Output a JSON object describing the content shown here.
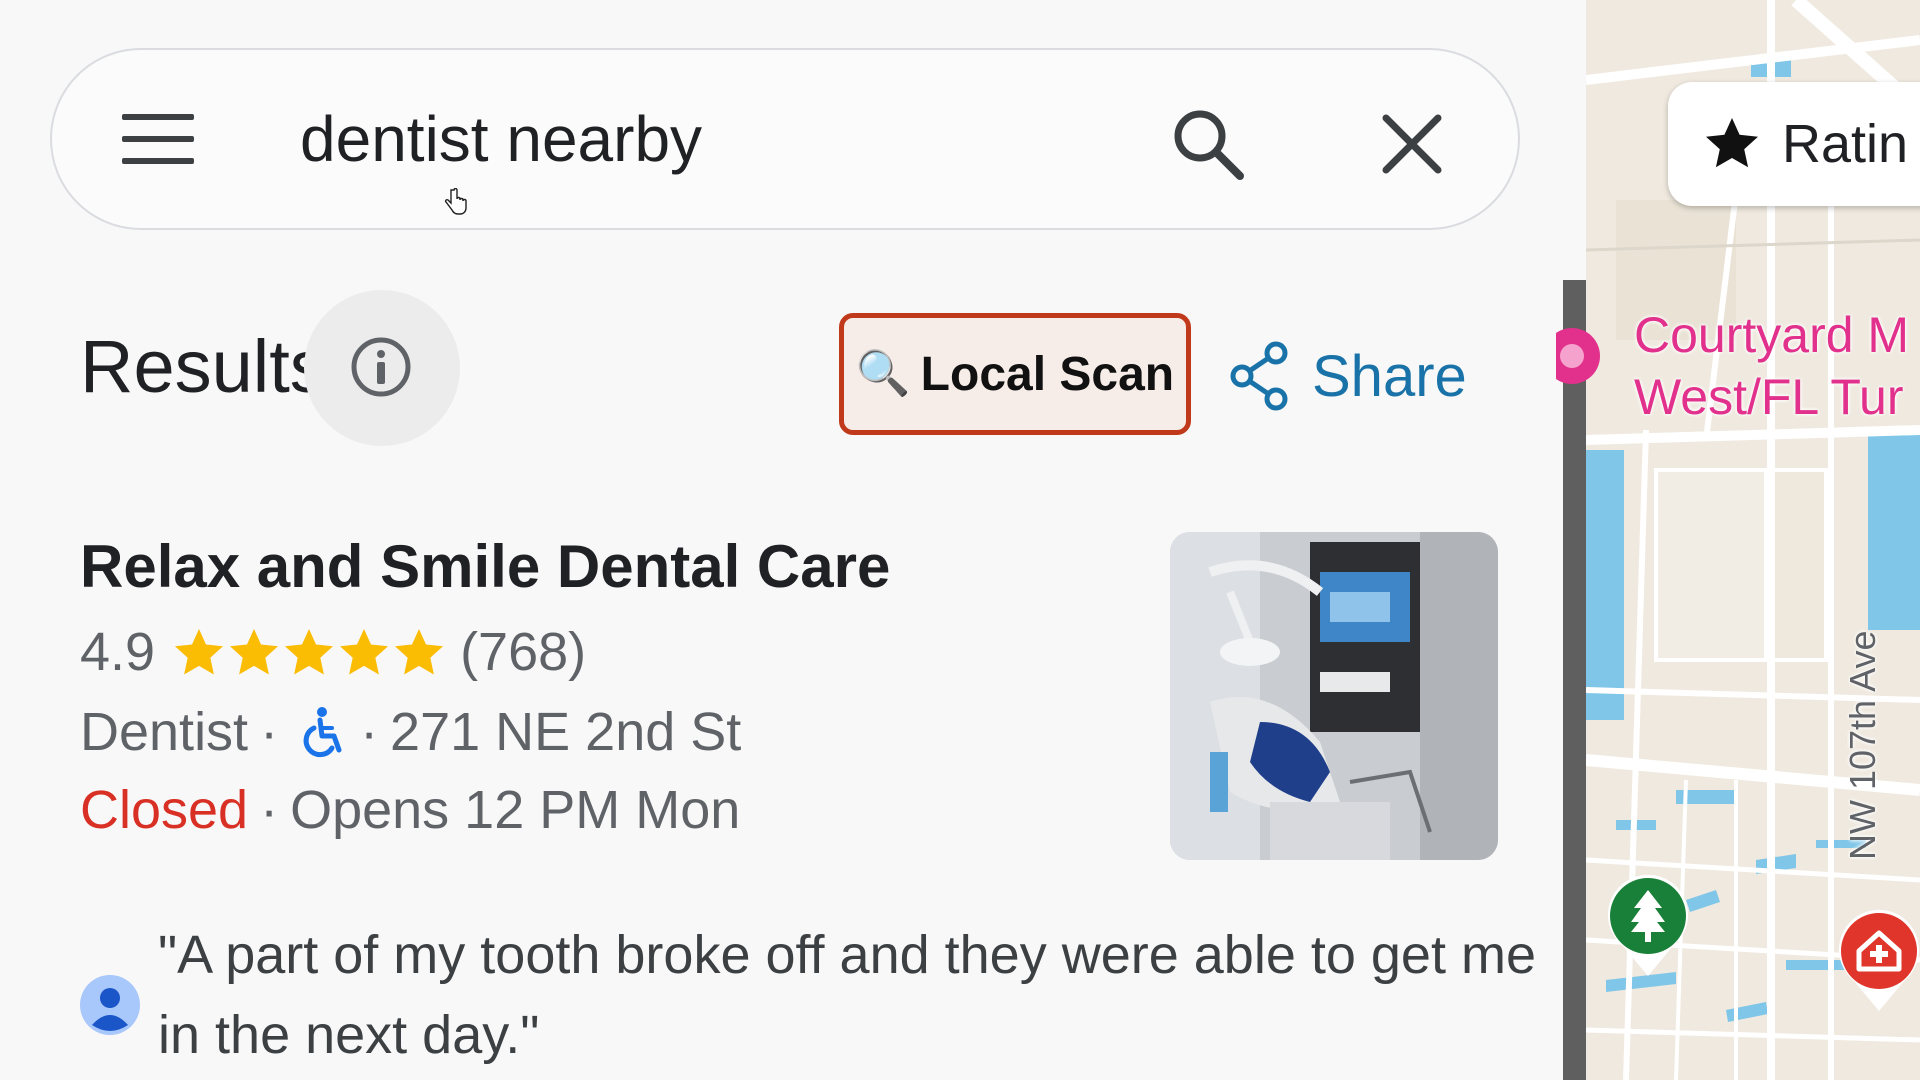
{
  "search": {
    "query": "dentist nearby"
  },
  "results_header": {
    "title": "Results",
    "local_scan_label": "Local Scan",
    "share_label": "Share"
  },
  "result": {
    "name": "Relax and Smile Dental Care",
    "rating": "4.9",
    "rating_value": 4.9,
    "star_count": 5,
    "review_count": "(768)",
    "category": "Dentist",
    "separator": "·",
    "address": "271 NE 2nd St",
    "status": "Closed",
    "hours": "Opens 12 PM Mon",
    "review_snippet": "\"A part of my tooth broke off and they were able to get me in the next day.\"",
    "icons": {
      "accessibility": "wheelchair-icon",
      "avatar": "user-avatar-icon"
    }
  },
  "map": {
    "chip_label": "Ratin",
    "poi_label_line1": "Courtyard M",
    "poi_label_line2": "West/FL Tur",
    "street_label": "NW 107th Ave"
  },
  "colors": {
    "accent_blue": "#1a73a8",
    "closed_red": "#d93025",
    "star_gold": "#fbbc04",
    "highlight_border": "#c0391b",
    "poi_pink": "#e1318c",
    "park_green": "#188038",
    "hospital_red": "#e0352b"
  }
}
